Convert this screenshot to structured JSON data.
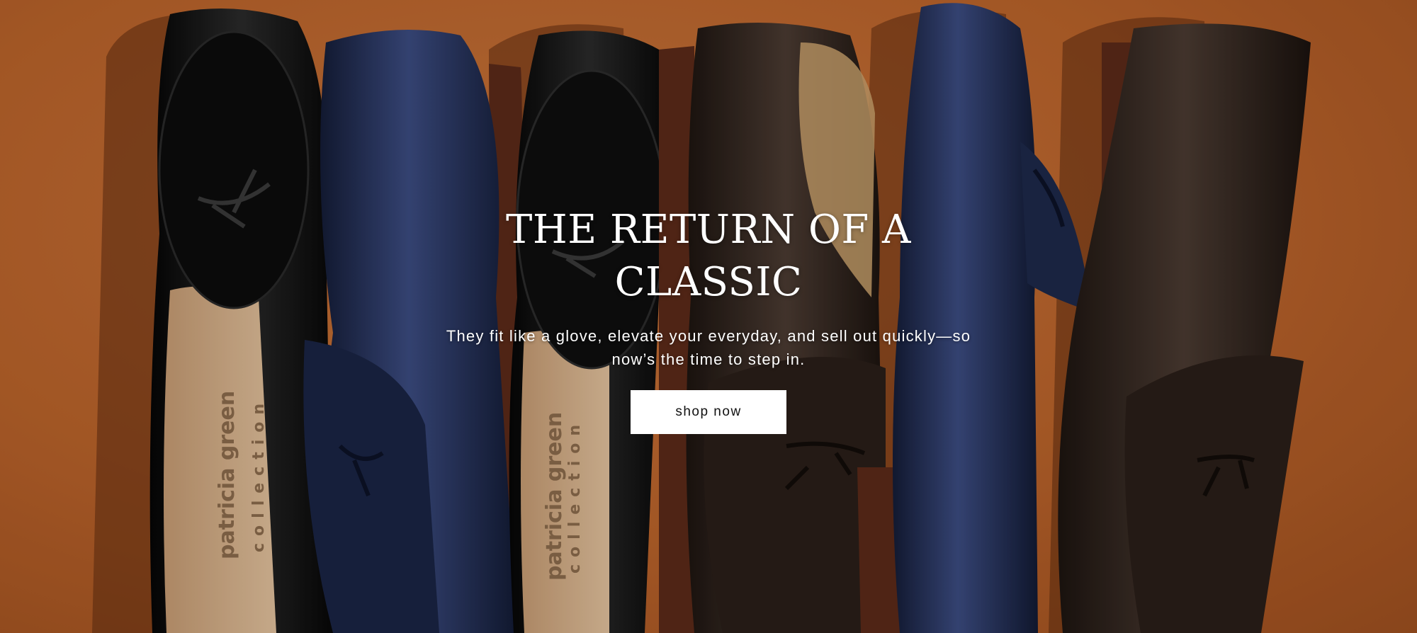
{
  "hero": {
    "headline_line1": "THE RETURN OF A",
    "headline_line2": "CLASSIC",
    "subtext_line1": "They fit like a glove, elevate your everyday, and sell out quickly—so",
    "subtext_line2": "now’s the time to step in.",
    "cta_label": "shop now",
    "insole_brand": "patricia green",
    "insole_sub": "collection"
  },
  "colors": {
    "background": "#b8622a",
    "black_leather": "#121212",
    "navy_leather": "#1f2a4d",
    "brown_leather": "#2e221c",
    "sole": "#5a2a18",
    "insole": "#d6b48f",
    "cta_bg": "#ffffff",
    "cta_text": "#111111",
    "text": "#ffffff"
  }
}
